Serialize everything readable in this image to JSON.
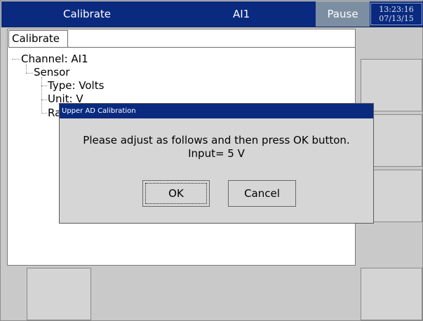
{
  "titlebar": {
    "title": "Calibrate",
    "channel": "AI1",
    "status": "Pause",
    "time": "13:23:16",
    "date": "07/13/15"
  },
  "panel": {
    "tab_label": "Calibrate",
    "tree": {
      "channel": "Channel: AI1",
      "sensor": "Sensor",
      "type": "Type: Volts",
      "unit": "Unit: V",
      "range_partial": "Ra"
    }
  },
  "dialog": {
    "title": "Upper AD Calibration",
    "message_line1": "Please adjust as follows and then press OK button.",
    "message_line2": "Input= 5 V",
    "ok_label": "OK",
    "cancel_label": "Cancel"
  }
}
